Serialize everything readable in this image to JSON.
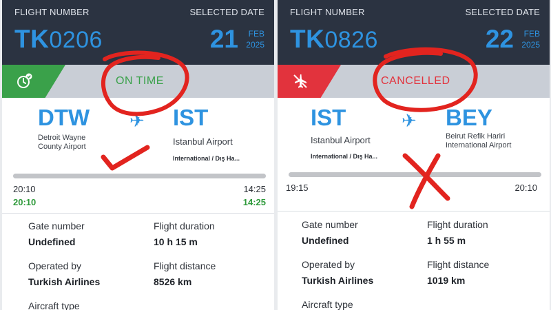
{
  "colors": {
    "header_bg": "#2b3341",
    "accent_blue": "#2e93e0",
    "on_time_green": "#3aa14a",
    "cancelled_red": "#e2333d",
    "actual_time_green": "#2f9a3b",
    "annotation_red": "#e2241f"
  },
  "left": {
    "header": {
      "flight_number_label": "FLIGHT NUMBER",
      "selected_date_label": "SELECTED DATE",
      "flight_prefix": "TK",
      "flight_digits": "0206",
      "day": "21",
      "month": "FEB",
      "year": "2025"
    },
    "status": {
      "text": "ON TIME",
      "icon": "clock-check-icon"
    },
    "route": {
      "origin_code": "DTW",
      "origin_name_line1": "Detroit Wayne",
      "origin_name_line2": "County Airport",
      "destination_code": "IST",
      "destination_name": "Istanbul Airport",
      "destination_terminal": "International / Dış Ha..."
    },
    "times": {
      "scheduled_departure": "20:10",
      "actual_departure": "20:10",
      "scheduled_arrival": "14:25",
      "actual_arrival": "14:25"
    },
    "details": {
      "gate_label": "Gate number",
      "gate_value": "Undefined",
      "duration_label": "Flight duration",
      "duration_value": "10 h 15 m",
      "operator_label": "Operated by",
      "operator_value": "Turkish Airlines",
      "distance_label": "Flight distance",
      "distance_value": "8526 km",
      "aircraft_label": "Aircraft type"
    }
  },
  "right": {
    "header": {
      "flight_number_label": "FLIGHT NUMBER",
      "selected_date_label": "SELECTED DATE",
      "flight_prefix": "TK",
      "flight_digits": "0826",
      "day": "22",
      "month": "FEB",
      "year": "2025"
    },
    "status": {
      "text": "CANCELLED",
      "icon": "plane-crossed-icon"
    },
    "route": {
      "origin_code": "IST",
      "origin_name": "Istanbul Airport",
      "origin_terminal": "International / Dış Ha...",
      "destination_code": "BEY",
      "destination_name_line1": "Beirut Refik Hariri",
      "destination_name_line2": "International Airport"
    },
    "times": {
      "scheduled_departure": "19:15",
      "scheduled_arrival": "20:10"
    },
    "details": {
      "gate_label": "Gate number",
      "gate_value": "Undefined",
      "duration_label": "Flight duration",
      "duration_value": "1 h 55 m",
      "operator_label": "Operated by",
      "operator_value": "Turkish Airlines",
      "distance_label": "Flight distance",
      "distance_value": "1019 km",
      "aircraft_label": "Aircraft type"
    }
  }
}
